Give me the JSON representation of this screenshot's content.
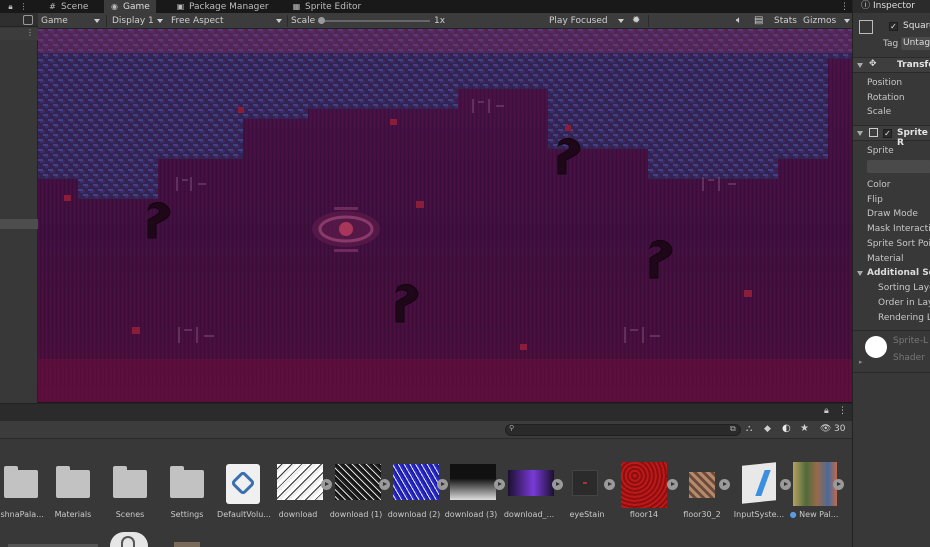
{
  "tabs": [
    {
      "label": "Scene",
      "icon": "grid-icon"
    },
    {
      "label": "Game",
      "icon": "gamepad-icon"
    },
    {
      "label": "Package Manager",
      "icon": "package-icon"
    },
    {
      "label": "Sprite Editor",
      "icon": "sprite-icon"
    }
  ],
  "game_toolbar": {
    "view": "Game",
    "display": "Display 1",
    "aspect": "Free Aspect",
    "scale_label": "Scale",
    "scale_value": "1x",
    "play_mode": "Play Focused",
    "stats": "Stats",
    "gizmos": "Gizmos"
  },
  "inspector": {
    "title": "Inspector",
    "object_name": "Square",
    "tag_label": "Tag",
    "tag_value": "Untagg",
    "transform_header": "Transfo",
    "transform_fields": [
      "Position",
      "Rotation",
      "Scale"
    ],
    "sprite_renderer_header": "Sprite R",
    "sprite_fields": [
      "Sprite",
      "Color",
      "Flip",
      "Draw Mode",
      "Mask Interactio",
      "Sprite Sort Poin",
      "Material"
    ],
    "additional_header": "Additional Setti",
    "additional_fields": [
      "Sorting Laye",
      "Order in Laye",
      "Rendering La"
    ],
    "material_name": "Sprite-L",
    "shader_label": "Shader"
  },
  "project": {
    "hidden_count": "30",
    "assets": [
      {
        "label": "ishnaPala...",
        "kind": "folder"
      },
      {
        "label": "Materials",
        "kind": "folder"
      },
      {
        "label": "Scenes",
        "kind": "folder"
      },
      {
        "label": "Settings",
        "kind": "folder"
      },
      {
        "label": "DefaultVolu...",
        "kind": "volume"
      },
      {
        "label": "download",
        "kind": "texture-sketch"
      },
      {
        "label": "download (1)",
        "kind": "texture-noise"
      },
      {
        "label": "download (2)",
        "kind": "texture-blue"
      },
      {
        "label": "download (3)",
        "kind": "texture-dark"
      },
      {
        "label": "download_...",
        "kind": "texture-purple"
      },
      {
        "label": "eyeStain",
        "kind": "texture-stain"
      },
      {
        "label": "floor14",
        "kind": "texture-red"
      },
      {
        "label": "floor30_2",
        "kind": "texture-floor"
      },
      {
        "label": "InputSyste...",
        "kind": "input-system"
      },
      {
        "label": "New Pal...",
        "kind": "palette"
      }
    ]
  },
  "colors": {
    "game_bg": "#3d0f3a",
    "pattern_blue": "#34407a",
    "accent": "#5a8fd8"
  }
}
